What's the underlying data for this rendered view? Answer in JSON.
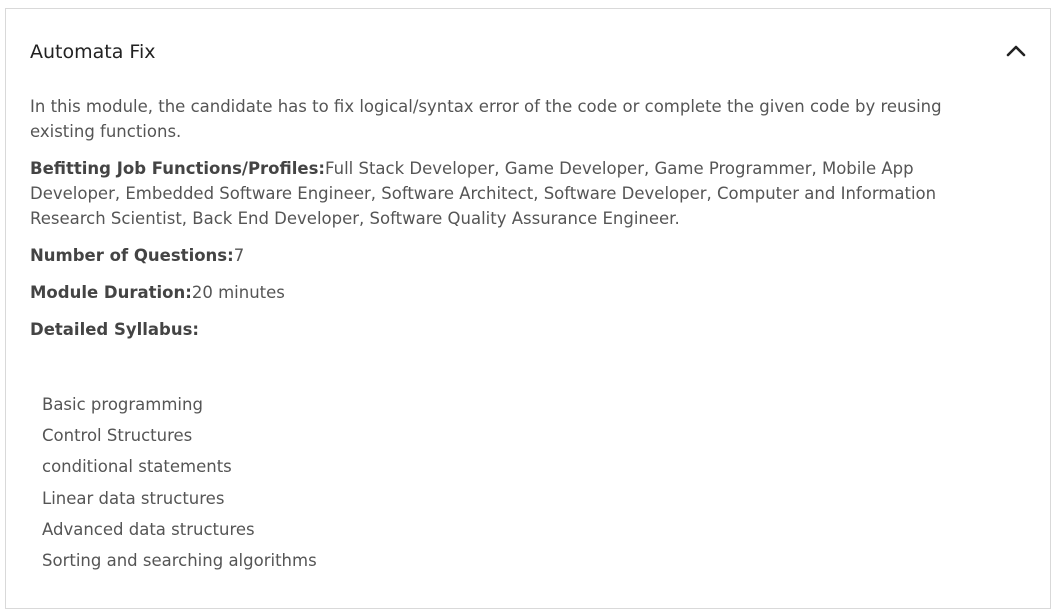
{
  "card": {
    "title": "Automata Fix",
    "toggle_icon": "chevron-up-icon",
    "description": "In this module, the candidate has to fix logical/syntax error of the code or complete the given code by reusing existing functions.",
    "profiles_label": "Befitting Job Functions/Profiles:",
    "profiles_value": "Full Stack Developer, Game Developer, Game Programmer, Mobile App Developer, Embedded Software Engineer, Software Architect, Software Developer, Computer and Information Research Scientist, Back End Developer, Software Quality Assurance Engineer.",
    "questions_label": "Number of Questions:",
    "questions_value": "7",
    "duration_label": "Module Duration:",
    "duration_value": "20 minutes",
    "syllabus_label": "Detailed Syllabus:",
    "syllabus": [
      "Basic programming",
      "Control Structures",
      "conditional statements",
      "Linear data structures",
      "Advanced data structures",
      "Sorting and searching algorithms"
    ]
  }
}
